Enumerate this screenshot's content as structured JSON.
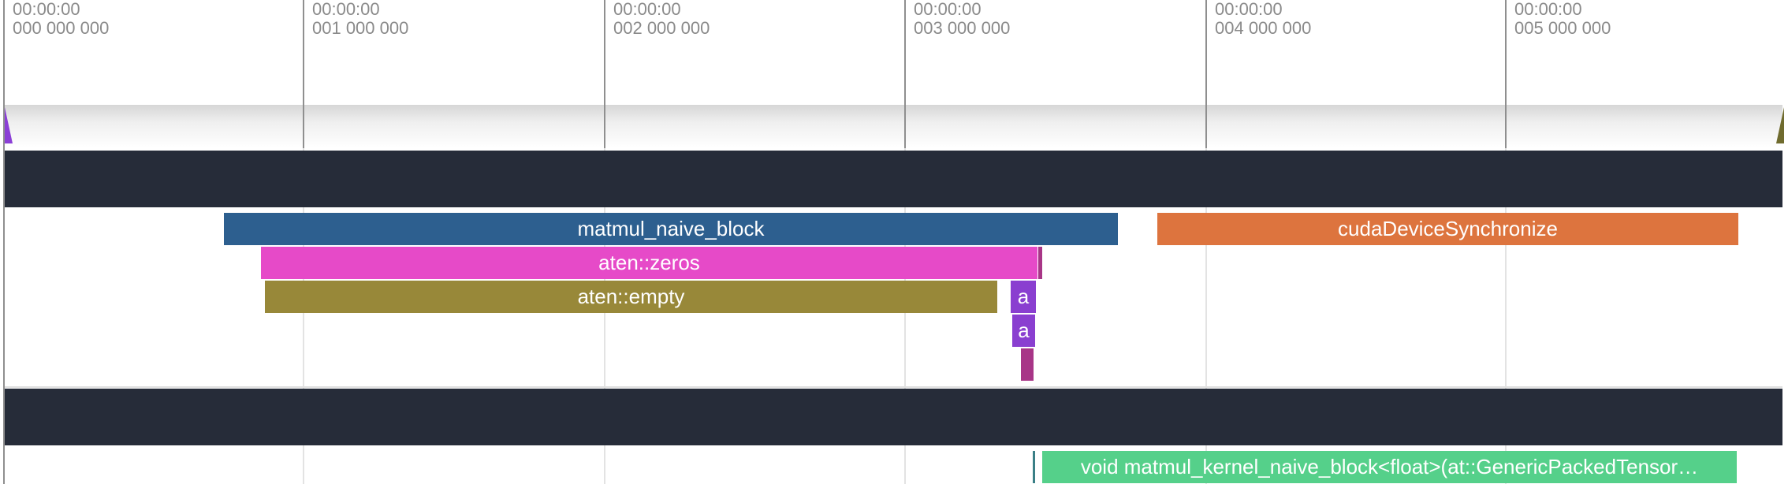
{
  "ruler": {
    "ticks": [
      {
        "time": "00:00:00",
        "ns": "000 000 000"
      },
      {
        "time": "00:00:00",
        "ns": "001 000 000"
      },
      {
        "time": "00:00:00",
        "ns": "002 000 000"
      },
      {
        "time": "00:00:00",
        "ns": "003 000 000"
      },
      {
        "time": "00:00:00",
        "ns": "004 000 000"
      },
      {
        "time": "00:00:00",
        "ns": "005 000 000"
      }
    ]
  },
  "colors": {
    "track_header": "#262c39",
    "matmul_naive_block": "#2d5f8f",
    "cudaDeviceSynchronize": "#dd743e",
    "aten_zeros": "#e64ac8",
    "aten_empty": "#988839",
    "small_slice_purple": "#8a3fd0",
    "small_slice_magenta": "#a83587",
    "kernel": "#55d08a"
  },
  "cpu_track": {
    "slices": [
      {
        "label": "matmul_naive_block"
      },
      {
        "label": "cudaDeviceSynchronize"
      },
      {
        "label": "aten::zeros"
      },
      {
        "label": "aten::empty"
      },
      {
        "label": "a"
      },
      {
        "label": "a"
      }
    ]
  },
  "gpu_track": {
    "slices": [
      {
        "label": "void matmul_kernel_naive_block<float>(at::GenericPackedTensor…"
      }
    ]
  }
}
